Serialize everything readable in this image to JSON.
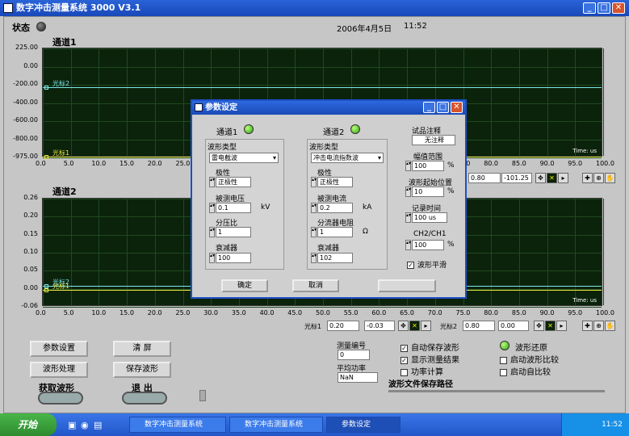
{
  "window": {
    "title": "数字冲击测量系统 3000 V3.1"
  },
  "status": {
    "label": "状态",
    "date": "2006年4月5日",
    "time": "11:52"
  },
  "ch1": {
    "title": "通道1",
    "yticks": [
      "225.00",
      "0.00",
      "-200.00",
      "-400.00",
      "-600.00",
      "-800.00",
      "-975.00"
    ],
    "cursor2": "光标2",
    "cursor1": "光标1",
    "xunit": "Time: us"
  },
  "ch2": {
    "title": "通道2",
    "yticks": [
      "0.26",
      "0.20",
      "0.15",
      "0.10",
      "0.05",
      "0.00",
      "-0.06"
    ],
    "cursor2": "光标2",
    "cursor1": "光标1",
    "xunit": "Time: us"
  },
  "xticks": [
    "0.0",
    "5.0",
    "10.0",
    "15.0",
    "20.0",
    "25.0",
    "30.0",
    "35.0",
    "40.0",
    "45.0",
    "50.0",
    "55.0",
    "60.0",
    "65.0",
    "70.0",
    "75.0",
    "80.0",
    "85.0",
    "90.0",
    "95.0",
    "100.0"
  ],
  "ch1_cursor_row": {
    "c2x": "0.80",
    "c2y": "-101.25"
  },
  "ch2_cursor_row": {
    "c1label": "光标1",
    "c1x": "0.20",
    "c1y": "-0.03",
    "c2label": "光标2",
    "c2x": "0.80",
    "c2y": "0.00"
  },
  "buttons": {
    "params": "参数设置",
    "clear": "清 屏",
    "process": "波形处理",
    "save": "保存波形",
    "acquire": "获取波形",
    "exit": "退 出"
  },
  "meas": {
    "num_label": "测量编号",
    "num_value": "0",
    "power_label": "平均功率",
    "power_value": "NaN",
    "path_label": "波形文件保存路径"
  },
  "checks": {
    "autosave": "自动保存波形",
    "showresult": "显示测量结果",
    "powercalc": "功率计算",
    "restore": "波形还原",
    "compare": "启动波形比较",
    "autocompare": "启动自比较"
  },
  "dialog": {
    "title": "参数设定",
    "ch1": {
      "label": "通道1",
      "wave_type_label": "波形类型",
      "wave_type": "雷电截波",
      "polarity_label": "极性",
      "polarity": "正极性",
      "measured_label": "被测电压",
      "measured": "0.1",
      "measured_unit": "kV",
      "ratio_label": "分压比",
      "ratio": "1",
      "atten_label": "衰减器",
      "atten": "100"
    },
    "ch2": {
      "label": "通道2",
      "wave_type_label": "波形类型",
      "wave_type": "冲击电流指数波",
      "polarity_label": "极性",
      "polarity": "正极性",
      "measured_label": "被测电流",
      "measured": "0.2",
      "measured_unit": "kA",
      "ratio_label": "分流器电阻",
      "ratio": "1",
      "ratio_unit": "Ω",
      "atten_label": "衰减器",
      "atten": "102"
    },
    "side": {
      "note_label": "试品注释",
      "note": "无注释",
      "range_label": "幅值范围",
      "range": "100",
      "range_unit": "%",
      "start_label": "波形起始位置",
      "start": "10",
      "start_unit": "%",
      "rec_label": "记录时间",
      "rec": "100 us",
      "ratio_label": "CH2/CH1",
      "ratio": "100",
      "ratio_unit": "%",
      "smooth_label": "波形平滑"
    },
    "ok": "确定",
    "cancel": "取消"
  },
  "taskbar": {
    "start": "开始",
    "tasks": [
      "数字冲击测量系统",
      "数字冲击测量系统",
      "参数设定"
    ],
    "clock": "11:52"
  }
}
